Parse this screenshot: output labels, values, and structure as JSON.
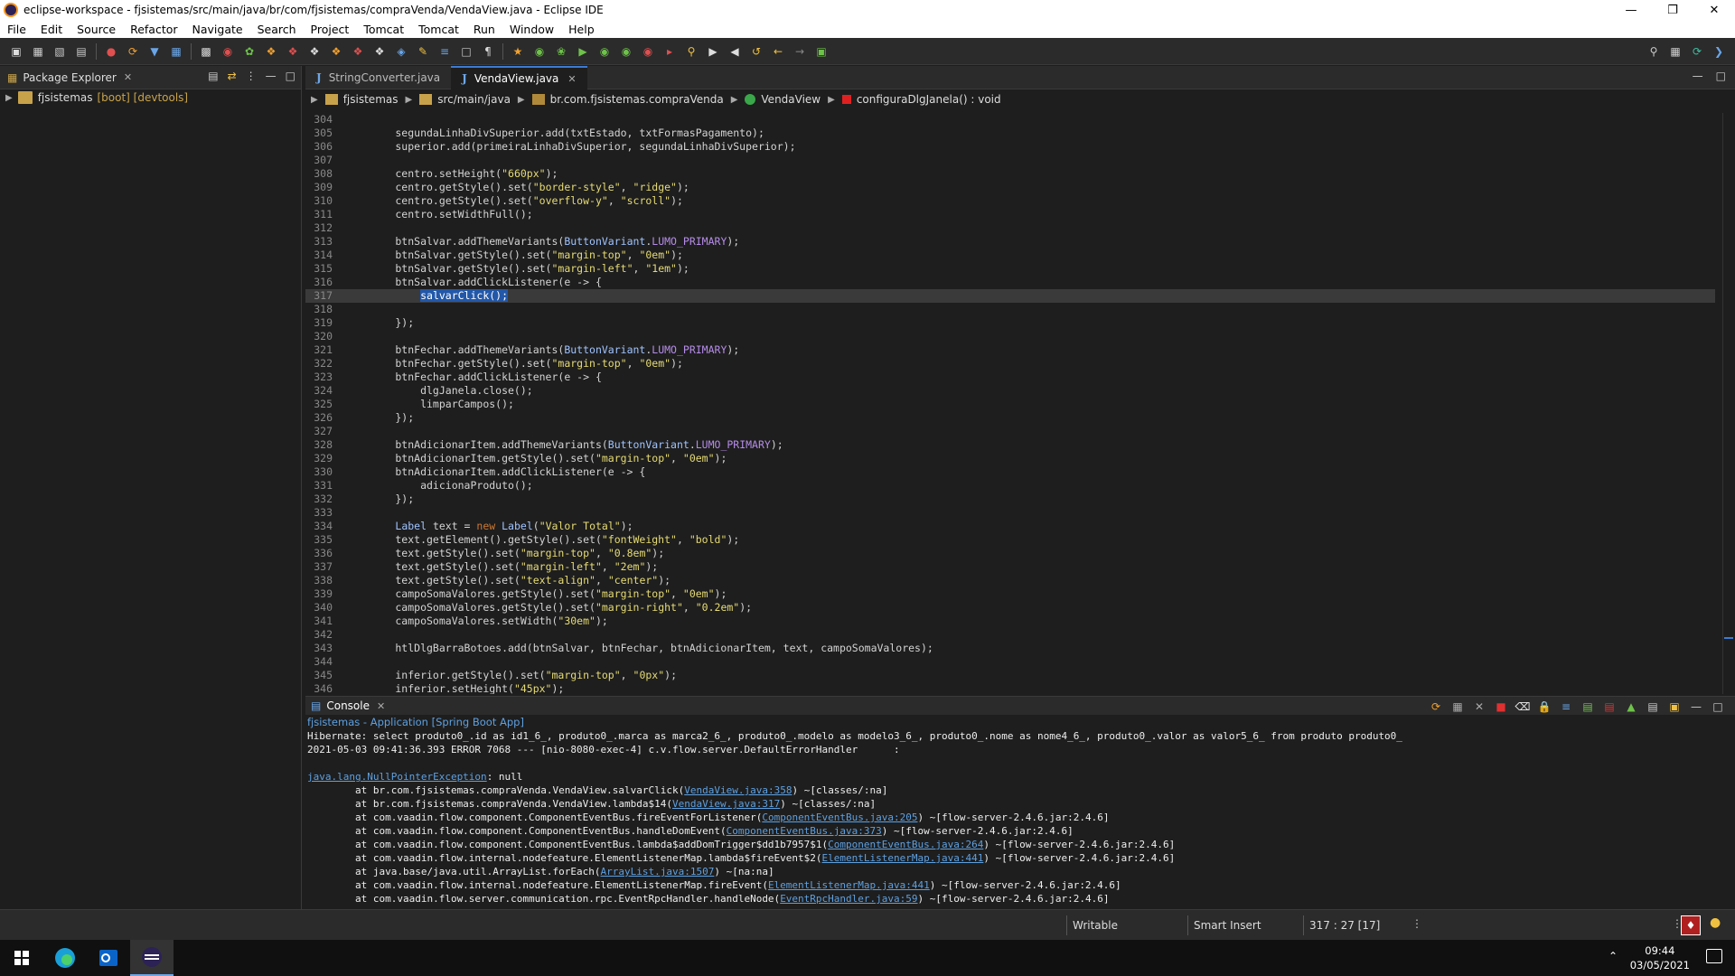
{
  "window": {
    "title": "eclipse-workspace - fjsistemas/src/main/java/br/com/fjsistemas/compraVenda/VendaView.java - Eclipse IDE"
  },
  "menu": [
    "File",
    "Edit",
    "Source",
    "Refactor",
    "Navigate",
    "Search",
    "Project",
    "Tomcat",
    "Tomcat",
    "Run",
    "Window",
    "Help"
  ],
  "package_explorer": {
    "tab_label": "Package Explorer",
    "project_name": "fjsistemas",
    "project_decorations": "[boot] [devtools]"
  },
  "editor": {
    "tabs": [
      {
        "label": "StringConverter.java",
        "active": false
      },
      {
        "label": "VendaView.java",
        "active": true
      }
    ],
    "breadcrumb": [
      "fjsistemas",
      "src/main/java",
      "br.com.fjsistemas.compraVenda",
      "VendaView",
      "configuraDlgJanela() : void"
    ],
    "lines": [
      {
        "n": "304",
        "code": ""
      },
      {
        "n": "305",
        "code": "        segundaLinhaDivSuperior.add(txtEstado, txtFormasPagamento);"
      },
      {
        "n": "306",
        "code": "        superior.add(primeiraLinhaDivSuperior, segundaLinhaDivSuperior);"
      },
      {
        "n": "307",
        "code": ""
      },
      {
        "n": "308",
        "code": "        centro.setHeight(\"660px\");"
      },
      {
        "n": "309",
        "code": "        centro.getStyle().set(\"border-style\", \"ridge\");"
      },
      {
        "n": "310",
        "code": "        centro.getStyle().set(\"overflow-y\", \"scroll\");"
      },
      {
        "n": "311",
        "code": "        centro.setWidthFull();"
      },
      {
        "n": "312",
        "code": ""
      },
      {
        "n": "313",
        "code": "        btnSalvar.addThemeVariants(ButtonVariant.LUMO_PRIMARY);"
      },
      {
        "n": "314",
        "code": "        btnSalvar.getStyle().set(\"margin-top\", \"0em\");"
      },
      {
        "n": "315",
        "code": "        btnSalvar.getStyle().set(\"margin-left\", \"1em\");"
      },
      {
        "n": "316",
        "code": "        btnSalvar.addClickListener(e -> {"
      },
      {
        "n": "317",
        "code": "            salvarClick();",
        "highlight": true
      },
      {
        "n": "318",
        "code": ""
      },
      {
        "n": "319",
        "code": "        });"
      },
      {
        "n": "320",
        "code": ""
      },
      {
        "n": "321",
        "code": "        btnFechar.addThemeVariants(ButtonVariant.LUMO_PRIMARY);"
      },
      {
        "n": "322",
        "code": "        btnFechar.getStyle().set(\"margin-top\", \"0em\");"
      },
      {
        "n": "323",
        "code": "        btnFechar.addClickListener(e -> {"
      },
      {
        "n": "324",
        "code": "            dlgJanela.close();"
      },
      {
        "n": "325",
        "code": "            limparCampos();"
      },
      {
        "n": "326",
        "code": "        });"
      },
      {
        "n": "327",
        "code": ""
      },
      {
        "n": "328",
        "code": "        btnAdicionarItem.addThemeVariants(ButtonVariant.LUMO_PRIMARY);"
      },
      {
        "n": "329",
        "code": "        btnAdicionarItem.getStyle().set(\"margin-top\", \"0em\");"
      },
      {
        "n": "330",
        "code": "        btnAdicionarItem.addClickListener(e -> {"
      },
      {
        "n": "331",
        "code": "            adicionaProduto();"
      },
      {
        "n": "332",
        "code": "        });"
      },
      {
        "n": "333",
        "code": ""
      },
      {
        "n": "334",
        "code": "        Label text = new Label(\"Valor Total\");"
      },
      {
        "n": "335",
        "code": "        text.getElement().getStyle().set(\"fontWeight\", \"bold\");"
      },
      {
        "n": "336",
        "code": "        text.getStyle().set(\"margin-top\", \"0.8em\");"
      },
      {
        "n": "337",
        "code": "        text.getStyle().set(\"margin-left\", \"2em\");"
      },
      {
        "n": "338",
        "code": "        text.getStyle().set(\"text-align\", \"center\");"
      },
      {
        "n": "339",
        "code": "        campoSomaValores.getStyle().set(\"margin-top\", \"0em\");"
      },
      {
        "n": "340",
        "code": "        campoSomaValores.getStyle().set(\"margin-right\", \"0.2em\");"
      },
      {
        "n": "341",
        "code": "        campoSomaValores.setWidth(\"30em\");"
      },
      {
        "n": "342",
        "code": ""
      },
      {
        "n": "343",
        "code": "        htlDlgBarraBotoes.add(btnSalvar, btnFechar, btnAdicionarItem, text, campoSomaValores);"
      },
      {
        "n": "344",
        "code": ""
      },
      {
        "n": "345",
        "code": "        inferior.getStyle().set(\"margin-top\", \"0px\");"
      },
      {
        "n": "346",
        "code": "        inferior.setHeight(\"45px\");"
      }
    ]
  },
  "console": {
    "tab_label": "Console",
    "launch_description": "fjsistemas - Application [Spring Boot App]",
    "lines": [
      {
        "pre": "Hibernate: select produto0_.id as id1_6_, produto0_.marca as marca2_6_, produto0_.modelo as modelo3_6_, produto0_.nome as nome4_6_, produto0_.valor as valor5_6_ from produto produto0_",
        "link": "",
        "post": ""
      },
      {
        "pre": "2021-05-03 09:41:36.393 ERROR 7068 --- [nio-8080-exec-4] c.v.flow.server.DefaultErrorHandler      :",
        "link": "",
        "post": ""
      },
      {
        "pre": "",
        "link": "",
        "post": ""
      },
      {
        "pre": "",
        "link": "java.lang.NullPointerException",
        "post": ": null"
      },
      {
        "pre": "\tat br.com.fjsistemas.compraVenda.VendaView.salvarClick(",
        "link": "VendaView.java:358",
        "post": ") ~[classes/:na]"
      },
      {
        "pre": "\tat br.com.fjsistemas.compraVenda.VendaView.lambda$14(",
        "link": "VendaView.java:317",
        "post": ") ~[classes/:na]"
      },
      {
        "pre": "\tat com.vaadin.flow.component.ComponentEventBus.fireEventForListener(",
        "link": "ComponentEventBus.java:205",
        "post": ") ~[flow-server-2.4.6.jar:2.4.6]"
      },
      {
        "pre": "\tat com.vaadin.flow.component.ComponentEventBus.handleDomEvent(",
        "link": "ComponentEventBus.java:373",
        "post": ") ~[flow-server-2.4.6.jar:2.4.6]"
      },
      {
        "pre": "\tat com.vaadin.flow.component.ComponentEventBus.lambda$addDomTrigger$dd1b7957$1(",
        "link": "ComponentEventBus.java:264",
        "post": ") ~[flow-server-2.4.6.jar:2.4.6]"
      },
      {
        "pre": "\tat com.vaadin.flow.internal.nodefeature.ElementListenerMap.lambda$fireEvent$2(",
        "link": "ElementListenerMap.java:441",
        "post": ") ~[flow-server-2.4.6.jar:2.4.6]"
      },
      {
        "pre": "\tat java.base/java.util.ArrayList.forEach(",
        "link": "ArrayList.java:1507",
        "post": ") ~[na:na]"
      },
      {
        "pre": "\tat com.vaadin.flow.internal.nodefeature.ElementListenerMap.fireEvent(",
        "link": "ElementListenerMap.java:441",
        "post": ") ~[flow-server-2.4.6.jar:2.4.6]"
      },
      {
        "pre": "\tat com.vaadin.flow.server.communication.rpc.EventRpcHandler.handleNode(",
        "link": "EventRpcHandler.java:59",
        "post": ") ~[flow-server-2.4.6.jar:2.4.6]"
      }
    ]
  },
  "status": {
    "writable": "Writable",
    "insert_mode": "Smart Insert",
    "position": "317 : 27 [17]"
  },
  "taskbar": {
    "time": "09:44",
    "date": "03/05/2021"
  },
  "colors": {
    "accent": "#3b7bd4",
    "selection": "#2358a8",
    "link": "#5ea0e0"
  }
}
